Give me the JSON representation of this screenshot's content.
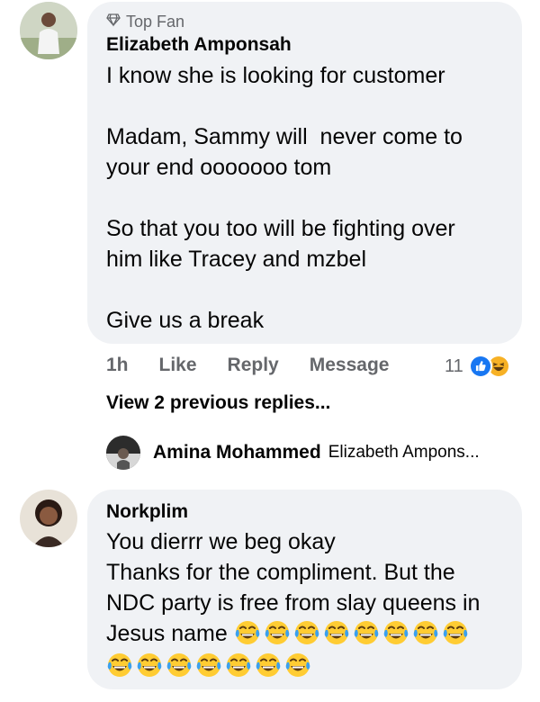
{
  "comments": [
    {
      "badge": "Top Fan",
      "author": "Elizabeth Amponsah",
      "paragraphs": [
        "I know she is looking for customer",
        "Madam, Sammy will  never come to\nyour end ooooooo tom",
        "So that you too will be fighting over\nhim like Tracey and mzbel",
        "Give us a break"
      ],
      "actions": {
        "time": "1h",
        "like": "Like",
        "reply": "Reply",
        "message": "Message"
      },
      "reaction_count": "11",
      "reaction_icons": [
        "like-icon",
        "haha-icon"
      ]
    },
    {
      "author": "Norkplim",
      "lines": [
        "You dierrr we beg okay",
        "Thanks for the compliment. But the",
        "NDC party is free from slay queens in",
        "Jesus name"
      ],
      "emoji": "face-with-tears-of-joy",
      "emoji_line1_count": 8,
      "emoji_line2_count": 7
    }
  ],
  "view_previous_replies": "View 2 previous replies...",
  "reply_preview": {
    "author": "Amina Mohammed",
    "text": "Elizabeth Ampons..."
  },
  "colors": {
    "bubble": "#f0f2f5",
    "meta_text": "#65676b",
    "like_blue": "#1877f2",
    "haha_yellow": "#f7b125"
  }
}
